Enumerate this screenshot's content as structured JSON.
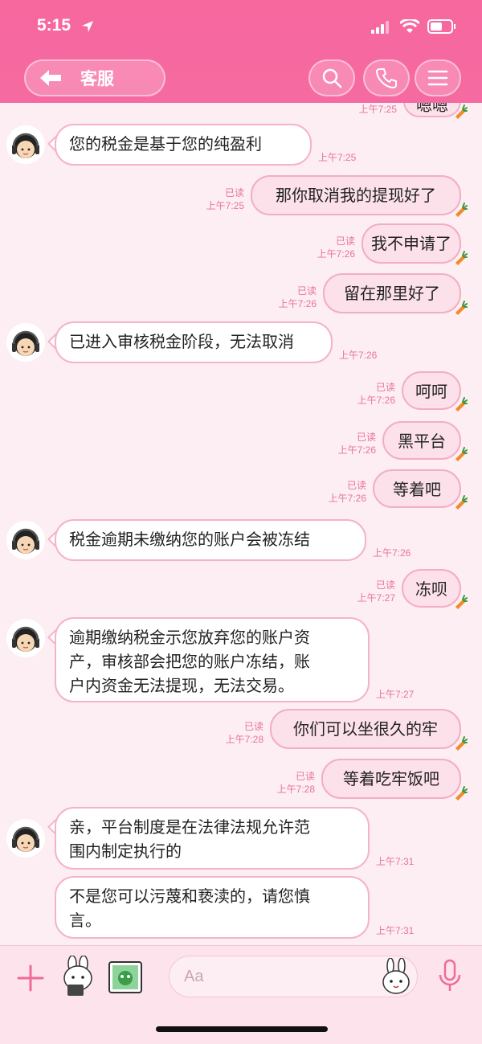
{
  "status_bar": {
    "time": "5:15"
  },
  "nav": {
    "title": "客服"
  },
  "colors": {
    "header_pink": "#f56aa0",
    "bubble_border": "#f5b3c8",
    "meta_pink": "#e8739a"
  },
  "messages": [
    {
      "side": "out",
      "text": "嗯嗯",
      "time": "上午7:25",
      "read": ""
    },
    {
      "side": "in",
      "text": "您的税金是基于您的纯盈利",
      "time": "上午7:25"
    },
    {
      "side": "out",
      "text": "那你取消我的提现好了",
      "time": "上午7:25",
      "read": "已读"
    },
    {
      "side": "out",
      "text": "我不申请了",
      "time": "上午7:26",
      "read": "已读"
    },
    {
      "side": "out",
      "text": "留在那里好了",
      "time": "上午7:26",
      "read": "已读"
    },
    {
      "side": "in",
      "text": "已进入审核税金阶段，无法取消",
      "time": "上午7:26"
    },
    {
      "side": "out",
      "text": "呵呵",
      "time": "上午7:26",
      "read": "已读"
    },
    {
      "side": "out",
      "text": "黑平台",
      "time": "上午7:26",
      "read": "已读"
    },
    {
      "side": "out",
      "text": "等着吧",
      "time": "上午7:26",
      "read": "已读"
    },
    {
      "side": "in",
      "text": "税金逾期未缴纳您的账户会被冻结",
      "time": "上午7:26"
    },
    {
      "side": "out",
      "text": "冻呗",
      "time": "上午7:27",
      "read": "已读"
    },
    {
      "side": "in",
      "lines": [
        "逾期缴纳税金示您放弃您的账户资",
        "产，审核部会把您的账户冻结，账",
        "户内资金无法提现，无法交易。"
      ],
      "time": "上午7:27"
    },
    {
      "side": "out",
      "text": "你们可以坐很久的牢",
      "time": "上午7:28",
      "read": "已读"
    },
    {
      "side": "out",
      "text": "等着吃牢饭吧",
      "time": "上午7:28",
      "read": "已读"
    },
    {
      "side": "in",
      "lines": [
        "亲，平台制度是在法律法规允许范",
        "围内制定执行的"
      ],
      "time": "上午7:31"
    },
    {
      "side": "in",
      "lines": [
        "不是您可以污蔑和亵渎的，请您慎",
        "言。"
      ],
      "time": "上午7:31"
    }
  ],
  "input": {
    "placeholder": "Aa"
  },
  "icons": {
    "back": "back-arrow-icon",
    "search": "search-icon",
    "call": "phone-icon",
    "menu": "menu-icon",
    "plus": "plus-icon",
    "sticker": "sticker-icon",
    "photo": "photo-icon",
    "emoji": "emoji-icon",
    "mic": "microphone-icon"
  }
}
